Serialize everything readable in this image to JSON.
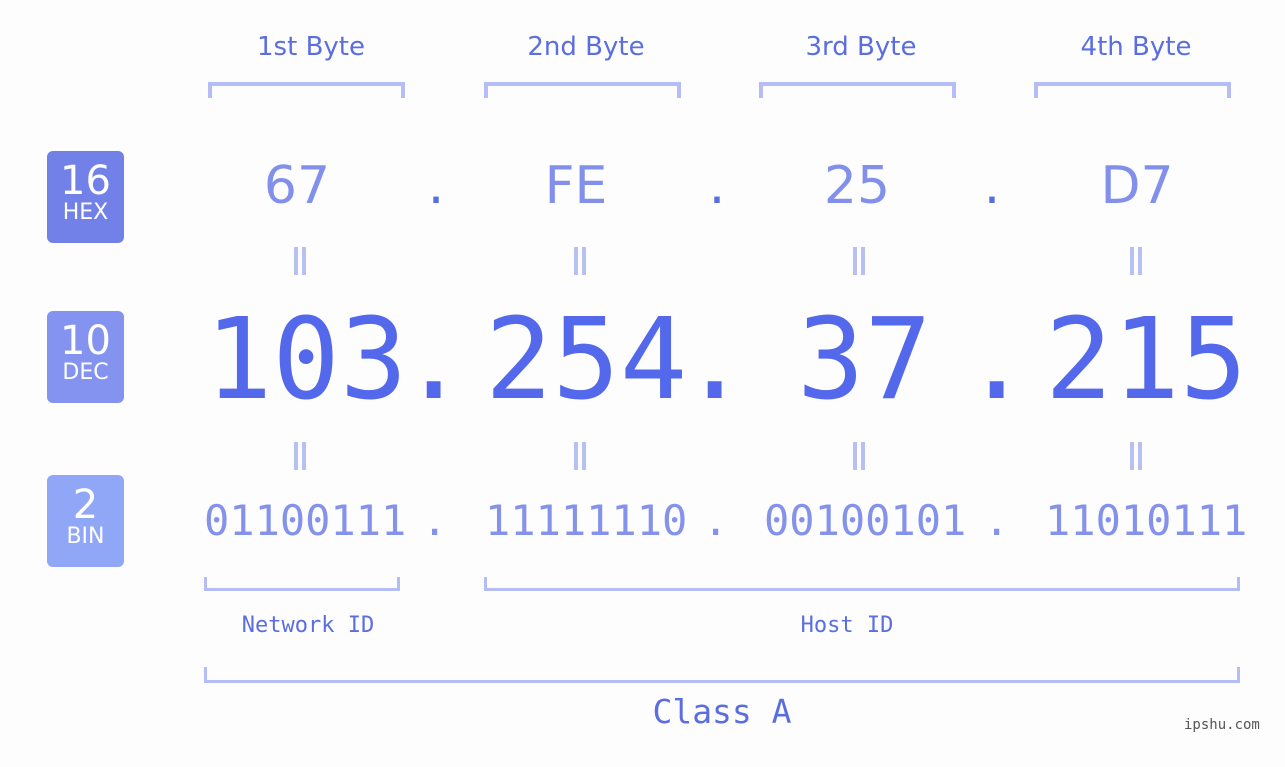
{
  "colors": {
    "accent": "#5468eb",
    "hex_badge": "#7181e8",
    "dec_badge": "#8393ef",
    "bin_badge": "#90a6f6",
    "bracket": "#b4bdf5"
  },
  "byte_headers": [
    "1st Byte",
    "2nd Byte",
    "3rd Byte",
    "4th Byte"
  ],
  "badges": {
    "hex": {
      "base": "16",
      "label": "HEX"
    },
    "dec": {
      "base": "10",
      "label": "DEC"
    },
    "bin": {
      "base": "2",
      "label": "BIN"
    }
  },
  "hex_values": [
    "67",
    "FE",
    "25",
    "D7"
  ],
  "dec_values": [
    "103",
    "254",
    "37",
    "215"
  ],
  "bin_values": [
    "01100111",
    "11111110",
    "00100101",
    "11010111"
  ],
  "separator": ".",
  "network_label": "Network ID",
  "host_label": "Host ID",
  "class_label": "Class A",
  "watermark": "ipshu.com"
}
